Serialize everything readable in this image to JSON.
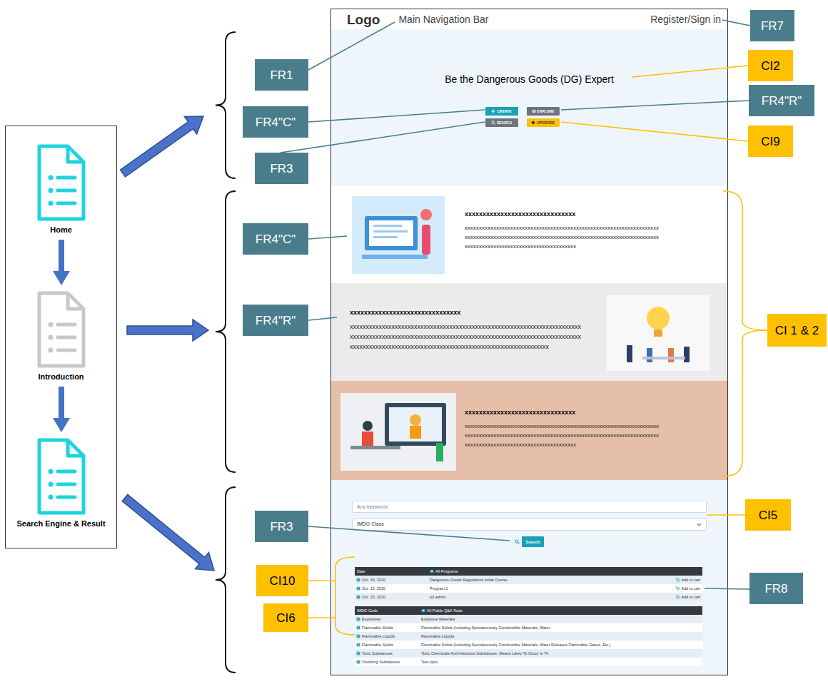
{
  "left_flow": {
    "pages": [
      {
        "label": "Home",
        "highlighted": true
      },
      {
        "label": "Introduction",
        "highlighted": false
      },
      {
        "label": "Search Engine & Result",
        "highlighted": true
      }
    ]
  },
  "mockup": {
    "nav": {
      "logo": "Logo",
      "caption": "Main Navigation Bar",
      "account": "Register/Sign in"
    },
    "hero": {
      "title": "Be the Dangerous Goods (DG) Expert",
      "buttons": [
        {
          "label": "CREATE",
          "color": "#17a2b8"
        },
        {
          "label": "EXPLORE",
          "color": "#6c757d"
        },
        {
          "label": "SEARCH",
          "color": "#6c757d"
        },
        {
          "label": "UPGRADE",
          "color": "#ffc107"
        }
      ]
    },
    "sections": [
      {
        "title": "xxxxxxxxxxxxxxxxxxxxxxxxxxxxxxx",
        "lines": [
          "xxxxxxxxxxxxxxxxxxxxxxxxxxxxxxxxxxxxxxxxxxxxxxxxxxxxxxxxxxxxxxxxxxxx",
          "xxxxxxxxxxxxxxxxxxxxxxxxxxxxxxxxxxxxxxxxxxxxxxxxxxxxxxxxxxxxxxxxxxxx",
          "xxxxxxxxxxxxxxxxxxxxxxxxxxxxxxxxxxxxxxx"
        ]
      },
      {
        "title": "xxxxxxxxxxxxxxxxxxxxxxxxxxxxxxx",
        "lines": [
          "xxxxxxxxxxxxxxxxxxxxxxxxxxxxxxxxxxxxxxxxxxxxxxxxxxxxxxxxxxxxxxxxxxxxxxxx",
          "xxxxxxxxxxxxxxxxxxxxxxxxxxxxxxxxxxxxxxxxxxxxxxxxxxxxxxxxxxxxxxxxxxxxxxxx",
          "xxxxxxxxxxxxxxxxxxxxxxxxxxxxxxxxxxxxxxxxxxxxxxxxxxxxxxxxxxxxxx"
        ]
      },
      {
        "title": "xxxxxxxxxxxxxxxxxxxxxxxxxxxxxxx",
        "lines": [
          "xxxxxxxxxxxxxxxxxxxxxxxxxxxxxxxxxxxxxxxxxxxxxxxxxxxxxxxxxxxxxxxxxxxx",
          "xxxxxxxxxxxxxxxxxxxxxxxxxxxxxxxxxxxxxxxxxxxxxxxxxxxxxxxxxxxxxxxxxxxx",
          "xxxxxxxxxxxxxxxxxxxxxxxxxxxxxxxxxxxxxxx"
        ]
      }
    ],
    "search": {
      "placeholder": "Any keywords",
      "filter": "IMDG Class",
      "button": "Search"
    },
    "programs": {
      "columns": [
        "Date",
        "All Programs"
      ],
      "rows": [
        {
          "date": "Oct. 16, 2020",
          "program": "Dangerous Goods Regulations Initial Course",
          "action": "Add to cart"
        },
        {
          "date": "Oct. 15, 2020",
          "program": "Program 2",
          "action": "Add to cart"
        },
        {
          "date": "Oct. 15, 2020",
          "program": "p3 admin",
          "action": "Add to cart"
        }
      ]
    },
    "topics": {
      "columns": [
        "IMDG Code",
        "All Public Q&A Topic"
      ],
      "rows": [
        {
          "code": "Explosives",
          "topic": "Explosive Materials"
        },
        {
          "code": "Flammable Solids",
          "topic": "Flammable Solids (Including Spontaneously Combustible Materials, Water"
        },
        {
          "code": "Flammable Liquids",
          "topic": "Flammable Liquids"
        },
        {
          "code": "Flammable Solids",
          "topic": "Flammable Solids (Including Spontaneously Combustible Materials, Water Releases Flammable Gases, Etc.)"
        },
        {
          "code": "Toxic Substances",
          "topic": "Toxic Chemicals And Infectious Substances: Means Likely To Occur In Th"
        },
        {
          "code": "Oxidizing Substances",
          "topic": "Test topic"
        }
      ]
    }
  },
  "labels": [
    {
      "text": "FR7",
      "kind": "requirement"
    },
    {
      "text": "FR1",
      "kind": "requirement"
    },
    {
      "text": "CI2",
      "kind": "content"
    },
    {
      "text": "FR4\"C\"",
      "kind": "requirement"
    },
    {
      "text": "FR4\"R\"",
      "kind": "requirement"
    },
    {
      "text": "CI9",
      "kind": "content"
    },
    {
      "text": "FR3",
      "kind": "requirement"
    },
    {
      "text": "FR4\"C\"",
      "kind": "requirement"
    },
    {
      "text": "FR4\"R\"",
      "kind": "requirement"
    },
    {
      "text": "CI 1 & 2",
      "kind": "content"
    },
    {
      "text": "CI5",
      "kind": "content"
    },
    {
      "text": "FR3",
      "kind": "requirement"
    },
    {
      "text": "CI10",
      "kind": "content"
    },
    {
      "text": "FR8",
      "kind": "requirement"
    },
    {
      "text": "CI6",
      "kind": "content"
    }
  ]
}
